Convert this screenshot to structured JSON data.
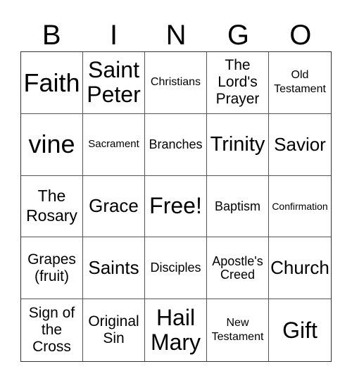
{
  "header": {
    "letters": [
      "B",
      "I",
      "N",
      "G",
      "O"
    ]
  },
  "grid": {
    "rows": [
      [
        "Faith",
        "Saint Peter",
        "Christians",
        "The Lord's Prayer",
        "Old Testament"
      ],
      [
        "vine",
        "Sacrament",
        "Branches",
        "Trinity",
        "Savior"
      ],
      [
        "The Rosary",
        "Grace",
        "Free!",
        "Baptism",
        "Confirmation"
      ],
      [
        "Grapes (fruit)",
        "Saints",
        "Disciples",
        "Apostle's Creed",
        "Church"
      ],
      [
        "Sign of the Cross",
        "Original Sin",
        "Hail Mary",
        "New Testament",
        "Gift"
      ]
    ],
    "free_space": "Free!"
  }
}
